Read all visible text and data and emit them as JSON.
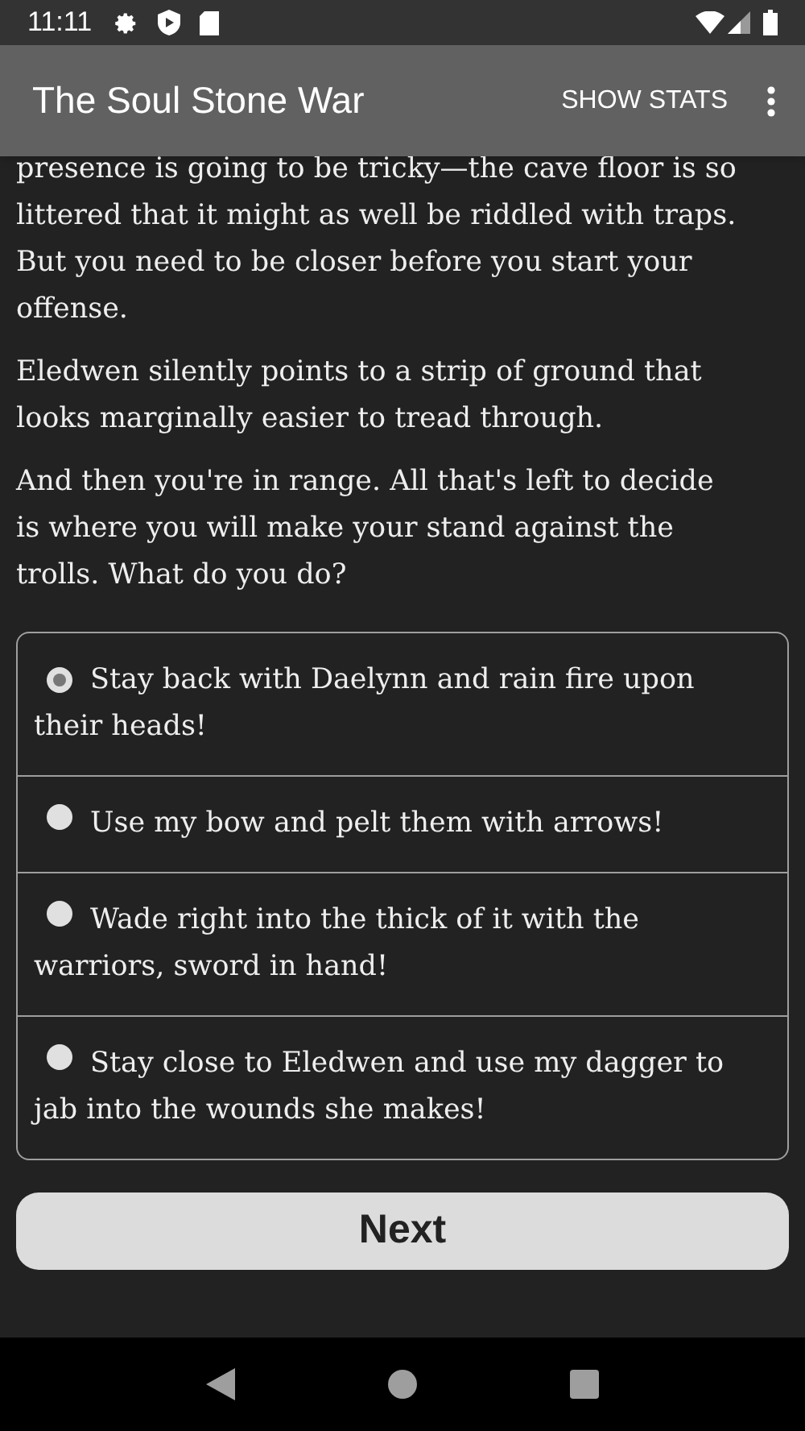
{
  "status_bar": {
    "time": "11:11"
  },
  "app_bar": {
    "title": "The Soul Stone War",
    "action": "SHOW STATS"
  },
  "paragraphs": [
    "presence is going to be tricky—the cave floor is so littered that it might as well be riddled with traps. But you need to be closer before you start your offense.",
    "Eledwen silently points to a strip of ground that looks marginally easier to tread through.",
    "And then you're in range. All that's left to decide is where you will make your stand against the trolls. What do you do?"
  ],
  "choices": [
    {
      "label": "Stay back with Daelynn and rain fire upon their heads!",
      "selected": true
    },
    {
      "label": "Use my bow and pelt them with arrows!",
      "selected": false
    },
    {
      "label": "Wade right into the thick of it with the warriors, sword in hand!",
      "selected": false
    },
    {
      "label": "Stay close to Eledwen and use my dagger to jab into the wounds she makes!",
      "selected": false
    }
  ],
  "next_button": "Next"
}
